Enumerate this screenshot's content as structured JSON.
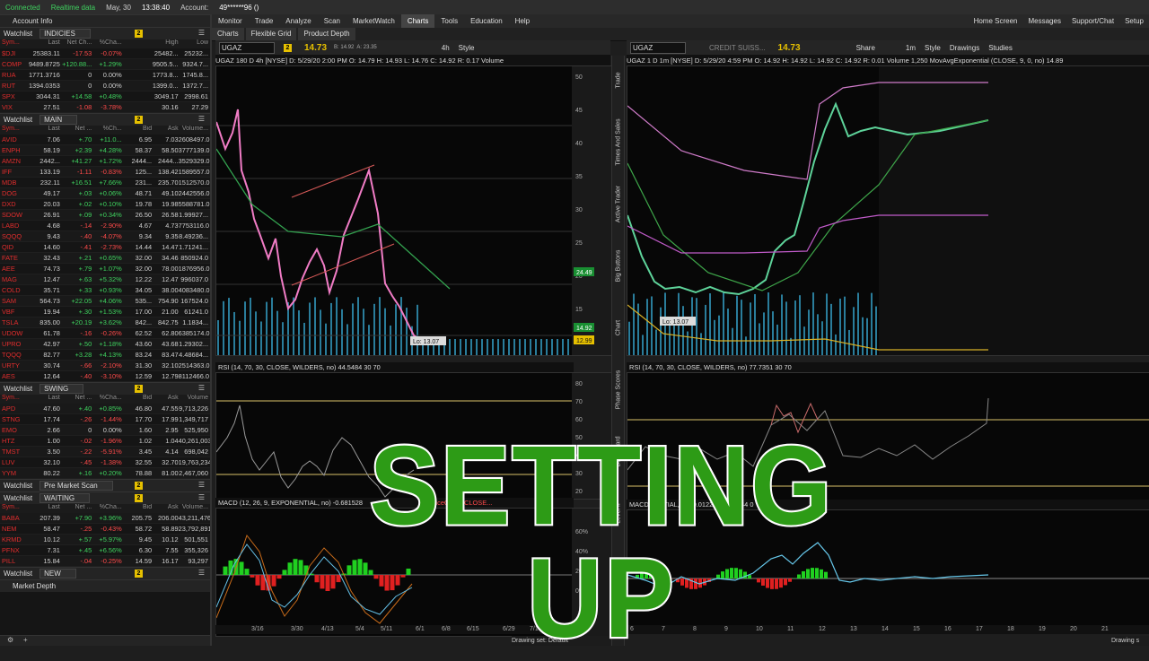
{
  "status": {
    "connected": "Connected",
    "realtime": "Realtime data",
    "date": "May, 30",
    "time": "13:38:40",
    "account_label": "Account:",
    "account_value": "49******96 ()"
  },
  "menu": [
    "Monitor",
    "Trade",
    "Analyze",
    "Scan",
    "MarketWatch",
    "Charts",
    "Tools",
    "Education",
    "Help"
  ],
  "menu_right": [
    "Home Screen",
    "Messages",
    "Support/Chat",
    "Setup"
  ],
  "subtabs": [
    "Charts",
    "Flexible Grid",
    "Product Depth"
  ],
  "left": {
    "account_info": "Account Info",
    "watchlists": [
      {
        "title": "Watchlist",
        "name": "INDICIES",
        "columns": [
          "Sym...",
          "Last",
          "Net Ch...",
          "%Cha...",
          "",
          "High",
          "Low"
        ],
        "rows": [
          [
            "$DJI",
            "25383.11",
            "-17.53",
            "-0.07%",
            "",
            "25482...",
            "25232..."
          ],
          [
            "COMP",
            "9489.8725",
            "+120.88...",
            "+1.29%",
            "",
            "9505.5...",
            "9324.7..."
          ],
          [
            "RUA",
            "1771.3716",
            "0",
            "0.00%",
            "",
            "1773.8...",
            "1745.8..."
          ],
          [
            "RUT",
            "1394.0353",
            "0",
            "0.00%",
            "",
            "1399.0...",
            "1372.7..."
          ],
          [
            "SPX",
            "3044.31",
            "+14.58",
            "+0.48%",
            "",
            "3049.17",
            "2998.61"
          ],
          [
            "VIX",
            "27.51",
            "-1.08",
            "-3.78%",
            "",
            "30.16",
            "27.29"
          ]
        ]
      },
      {
        "title": "Watchlist",
        "name": "MAIN",
        "columns": [
          "Sym...",
          "Last",
          "Net ...",
          "%Ch...",
          "Bid",
          "Ask",
          "Volume..."
        ],
        "rows": [
          [
            "AVID",
            "7.06",
            "+.70",
            "+11.0...",
            "6.95",
            "7.03",
            "2608497.0"
          ],
          [
            "ENPH",
            "58.19",
            "+2.39",
            "+4.28%",
            "58.37",
            "58.50",
            "3777139.0"
          ],
          [
            "AMZN",
            "2442...",
            "+41.27",
            "+1.72%",
            "2444...",
            "2444...",
            "3529329.0"
          ],
          [
            "IFF",
            "133.19",
            "-1.11",
            "-0.83%",
            "125...",
            "138.42",
            "1589557.0"
          ],
          [
            "MDB",
            "232.11",
            "+16.51",
            "+7.66%",
            "231...",
            "235.70",
            "1512570.0"
          ],
          [
            "DOG",
            "49.17",
            "+.03",
            "+0.06%",
            "48.71",
            "49.10",
            "2442556.0"
          ],
          [
            "DXD",
            "20.03",
            "+.02",
            "+0.10%",
            "19.78",
            "19.98",
            "5588781.0"
          ],
          [
            "SDOW",
            "26.91",
            "+.09",
            "+0.34%",
            "26.50",
            "26.58",
            "1.99927..."
          ],
          [
            "LABD",
            "4.68",
            "-.14",
            "-2.90%",
            "4.67",
            "4.73",
            "7753116.0"
          ],
          [
            "SQQQ",
            "9.43",
            "-.40",
            "-4.07%",
            "9.34",
            "9.35",
            "8.49236..."
          ],
          [
            "QID",
            "14.60",
            "-.41",
            "-2.73%",
            "14.44",
            "14.47",
            "1.71241..."
          ],
          [
            "FATE",
            "32.43",
            "+.21",
            "+0.65%",
            "32.00",
            "34.46",
            "850924.0"
          ],
          [
            "AEE",
            "74.73",
            "+.79",
            "+1.07%",
            "32.00",
            "78.00",
            "1876956.0"
          ],
          [
            "MAG",
            "12.47",
            "+.63",
            "+5.32%",
            "12.22",
            "12.47",
            "996037.0"
          ],
          [
            "COLD",
            "35.71",
            "+.33",
            "+0.93%",
            "34.05",
            "38.00",
            "4083480.0"
          ],
          [
            "SAM",
            "564.73",
            "+22.05",
            "+4.06%",
            "535...",
            "754.90",
            "167524.0"
          ],
          [
            "VBF",
            "19.94",
            "+.30",
            "+1.53%",
            "17.00",
            "21.00",
            "61241.0"
          ],
          [
            "TSLA",
            "835.00",
            "+20.19",
            "+3.62%",
            "842...",
            "842.75",
            "1.1834..."
          ],
          [
            "UDOW",
            "61.78",
            "-.16",
            "-0.26%",
            "62.52",
            "62.80",
            "6385174.0"
          ],
          [
            "UPRO",
            "42.97",
            "+.50",
            "+1.18%",
            "43.60",
            "43.68",
            "1.29302..."
          ],
          [
            "TQQQ",
            "82.77",
            "+3.28",
            "+4.13%",
            "83.24",
            "83.47",
            "4.48684..."
          ],
          [
            "URTY",
            "30.74",
            "-.66",
            "-2.10%",
            "31.30",
            "32.10",
            "2514363.0"
          ],
          [
            "AES",
            "12.64",
            "-.40",
            "-3.10%",
            "12.59",
            "12.79",
            "8112466.0"
          ]
        ]
      },
      {
        "title": "Watchlist",
        "name": "SWING",
        "columns": [
          "Sym...",
          "Last",
          "Net ...",
          "%Cha...",
          "Bid",
          "Ask",
          "Volume"
        ],
        "rows": [
          [
            "APD",
            "47.60",
            "+.40",
            "+0.85%",
            "46.80",
            "47.55",
            "9,713,226"
          ],
          [
            "STNG",
            "17.74",
            "-.26",
            "-1.44%",
            "17.70",
            "17.99",
            "1,349,717"
          ],
          [
            "EMO",
            "2.66",
            "0",
            "0.00%",
            "1.60",
            "2.95",
            "525,950"
          ],
          [
            "HTZ",
            "1.00",
            "-.02",
            "-1.96%",
            "1.02",
            "1.04",
            "40,261,003"
          ],
          [
            "TMST",
            "3.50",
            "-.22",
            "-5.91%",
            "3.45",
            "4.14",
            "698,042"
          ],
          [
            "LUV",
            "32.10",
            "-.45",
            "-1.38%",
            "32.55",
            "32.70",
            "19,763,234"
          ],
          [
            "YYM",
            "80.22",
            "+.16",
            "+0.20%",
            "78.88",
            "81.00",
            "2,467,060"
          ]
        ]
      },
      {
        "title": "Watchlist",
        "name": "Pre Market Scan",
        "columns": [],
        "rows": []
      },
      {
        "title": "Watchlist",
        "name": "WAITING",
        "columns": [
          "Sym...",
          "Last",
          "Net ...",
          "%Cha...",
          "Bid",
          "Ask",
          "Volume..."
        ],
        "rows": [
          [
            "BABA",
            "207.39",
            "+7.90",
            "+3.96%",
            "205.75",
            "206.00",
            "43,211,476"
          ],
          [
            "NEM",
            "58.47",
            "-.25",
            "-0.43%",
            "58.72",
            "58.89",
            "23,792,891"
          ],
          [
            "KRMD",
            "10.12",
            "+.57",
            "+5.97%",
            "9.45",
            "10.12",
            "501,551"
          ],
          [
            "PFNX",
            "7.31",
            "+.45",
            "+6.56%",
            "6.30",
            "7.55",
            "355,326"
          ],
          [
            "PILL",
            "15.84",
            "-.04",
            "-0.25%",
            "14.59",
            "16.17",
            "93,297"
          ]
        ]
      },
      {
        "title": "Watchlist",
        "name": "NEW",
        "columns": [],
        "rows": []
      }
    ],
    "market_depth": "Market Depth"
  },
  "chart1": {
    "symbol": "UGAZ",
    "price": "14.73",
    "bid": "B: 14.92",
    "ask": "A: 23.35",
    "info": "UGAZ 180 D 4h [NYSE]   D: 5/29/20 2:00 PM   O: 14.79   H: 14.93   L: 14.76   C: 14.92   R: 0.17   Volume",
    "lo_label": "Lo: 13.07",
    "price_axis": [
      "50",
      "45",
      "40",
      "35",
      "30",
      "25",
      "20",
      "15",
      "10"
    ],
    "tags": [
      "24.49",
      "14.92",
      "12.99"
    ],
    "rsi_label": "RSI (14, 70, 30, CLOSE, WILDERS, no)  44.5484   30   70",
    "rsi_axis": [
      "80",
      "70",
      "60",
      "50",
      "40",
      "30",
      "20"
    ],
    "macd_label": "MACD (12, 26, 9, EXPONENTIAL, no)  -0.681528",
    "macd_extra": "PriceO... 9, CLOSE...",
    "macd_axis": [
      "60%",
      "40%",
      "20%",
      "0%"
    ],
    "dates": [
      "3/16",
      "3/30",
      "4/13",
      "5/4",
      "5/11",
      "6/1",
      "6/8",
      "6/15",
      "6/29",
      "7/13",
      "7/20"
    ],
    "tools": [
      "4h",
      "Style"
    ]
  },
  "chart2": {
    "symbol": "UGAZ",
    "company": "CREDIT SUISS...",
    "price": "14.73",
    "info": "UGAZ 1 D 1m [NYSE]   D: 5/29/20 4:59 PM   O: 14.92   H: 14.92   L: 14.92   C: 14.92   R: 0.01   Volume  1,250   MovAvgExponential (CLOSE, 9, 0, no)  14.89",
    "lo_label": "Lo: 13.07",
    "rsi_label": "RSI (14, 70, 30, CLOSE, WILDERS, no)  77.7351   30   70",
    "macd_label": "MACD...ENTIAL, no)  0.0122...  0.049844   0",
    "hours": [
      "6",
      "7",
      "8",
      "9",
      "10",
      "11",
      "12",
      "13",
      "14",
      "15",
      "16",
      "17",
      "18",
      "19",
      "20",
      "21"
    ],
    "tools": [
      "1m",
      "Share",
      "Style",
      "Drawings",
      "Studies"
    ]
  },
  "vertical_tabs": [
    "Trade",
    "Times And Sales",
    "Active Trader",
    "Big Buttons",
    "Chart",
    "Phase Scores",
    "Dashboard",
    "Level II",
    "News"
  ],
  "bottom": {
    "drawing_set": "Drawing set: Default",
    "drawing_set_short": "Drawing s"
  },
  "overlay": "SETTING UP",
  "colors": {
    "positive": "#3fd35f",
    "negative": "#ff4a4a",
    "accent": "#e6c000",
    "overlay_green": "#2d9b16"
  }
}
